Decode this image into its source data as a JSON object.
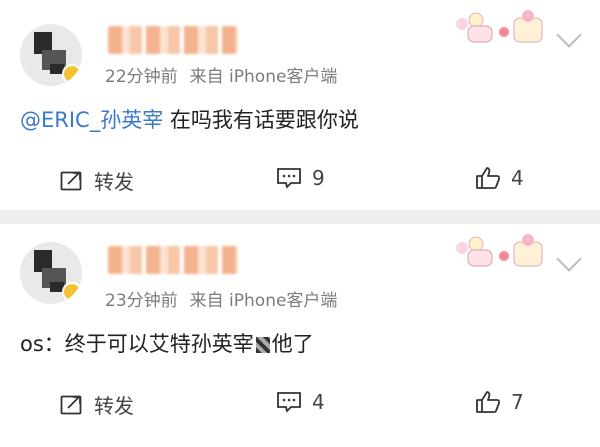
{
  "posts": [
    {
      "time": "22分钟前",
      "source": "来自 iPhone客户端",
      "mention": "@ERIC_孙英宰",
      "text": " 在吗我有话要跟你说",
      "repost_label": "转发",
      "comment_count": "9",
      "like_count": "4"
    },
    {
      "time": "23分钟前",
      "source": "来自 iPhone客户端",
      "mention": "",
      "text": "os：终于可以艾特孙英宰",
      "text_tail": "他了",
      "repost_label": "转发",
      "comment_count": "4",
      "like_count": "7"
    }
  ],
  "colors": {
    "mention": "#3b78c9",
    "meta": "#7c7c7c",
    "separator": "#efefef"
  },
  "icons": [
    "repost-icon",
    "comment-icon",
    "like-icon",
    "chevron-down-icon",
    "sticker-icon"
  ]
}
